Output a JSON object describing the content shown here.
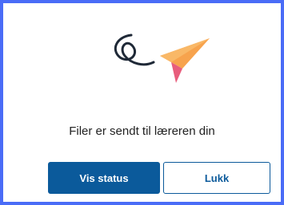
{
  "dialog": {
    "message": "Filer er sendt til læreren din",
    "primary_button_label": "Vis status",
    "secondary_button_label": "Lukk",
    "illustration_icon": "paper-plane-icon"
  },
  "colors": {
    "frame_border": "#4a6cf7",
    "primary": "#0b5a9b",
    "plane_orange": "#f7a34d",
    "plane_pink": "#e85d7c",
    "swirl": "#1f2937"
  }
}
